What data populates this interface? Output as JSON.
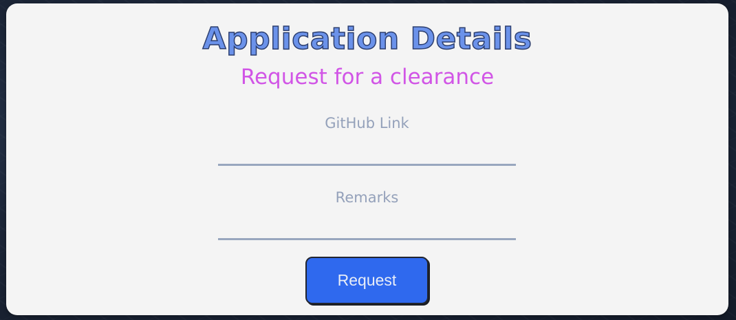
{
  "header": {
    "title": "Application Details",
    "subtitle": "Request for a clearance"
  },
  "form": {
    "github": {
      "label": "GitHub Link",
      "value": "",
      "placeholder": ""
    },
    "remarks": {
      "label": "Remarks",
      "value": "",
      "placeholder": ""
    },
    "submit_label": "Request"
  },
  "colors": {
    "title": "#6b92ea",
    "title_outline": "#2c3e6e",
    "subtitle": "#d155e6",
    "label": "#94a1ba",
    "underline": "#98a6be",
    "button": "#2f69ee",
    "card": "#f4f4f4"
  }
}
